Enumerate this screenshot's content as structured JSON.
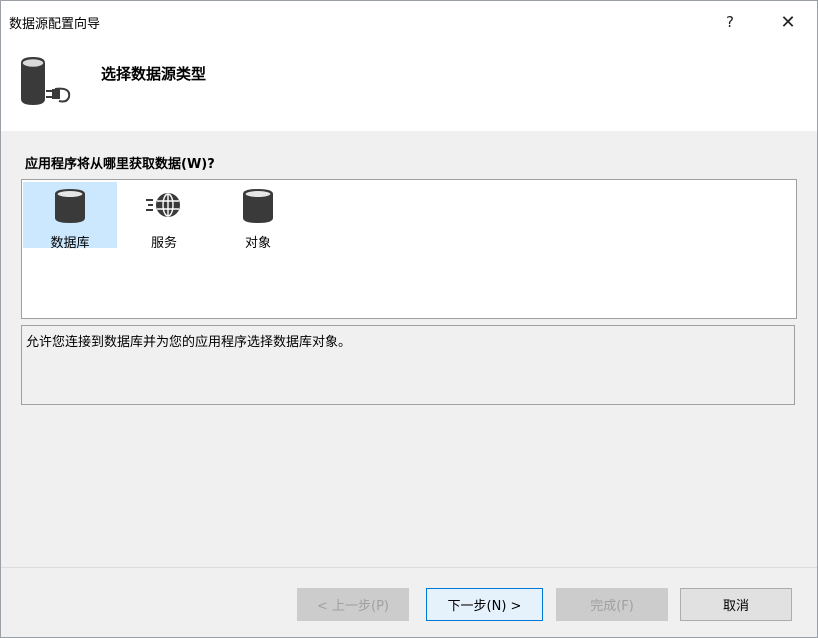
{
  "window": {
    "title": "数据源配置向导",
    "help_label": "?",
    "close_label": "✕"
  },
  "header": {
    "title": "选择数据源类型",
    "icon": "database-plug-icon"
  },
  "question": "应用程序将从哪里获取数据(W)?",
  "types": {
    "database": {
      "label": "数据库",
      "icon": "database-icon",
      "selected": true
    },
    "service": {
      "label": "服务",
      "icon": "globe-service-icon",
      "selected": false
    },
    "object": {
      "label": "对象",
      "icon": "database-icon",
      "selected": false
    }
  },
  "description": "允许您连接到数据库并为您的应用程序选择数据库对象。",
  "buttons": {
    "prev": {
      "label": "< 上一步(P)",
      "enabled": false
    },
    "next": {
      "label": "下一步(N) >",
      "enabled": true
    },
    "finish": {
      "label": "完成(F)",
      "enabled": false
    },
    "cancel": {
      "label": "取消",
      "enabled": true
    }
  },
  "colors": {
    "selected_item_bg": "#cce8ff",
    "accent_border": "#0078d7",
    "icon_dark": "#3a3a3a"
  }
}
